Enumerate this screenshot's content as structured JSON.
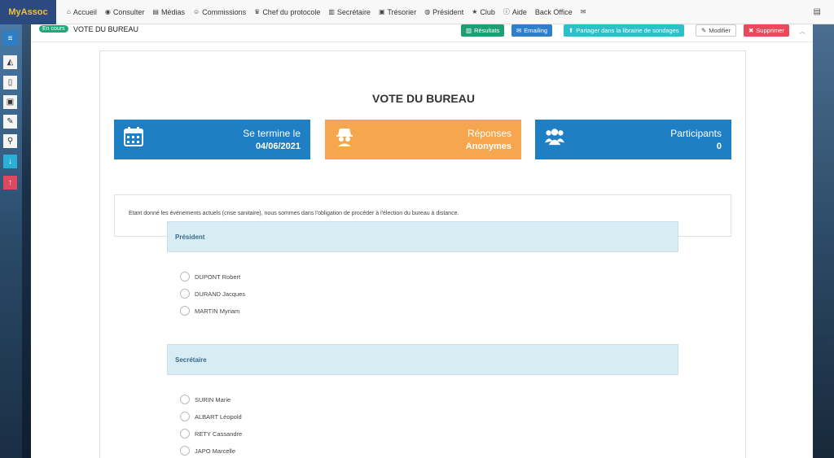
{
  "brand": "MyAssoc",
  "nav": [
    {
      "icon": "home-icon",
      "glyph": "⌂",
      "label": "Accueil"
    },
    {
      "icon": "eye-icon",
      "glyph": "◉",
      "label": "Consulter"
    },
    {
      "icon": "file-icon",
      "glyph": "▤",
      "label": "Médias"
    },
    {
      "icon": "user-circle-icon",
      "glyph": "☺",
      "label": "Commissions"
    },
    {
      "icon": "trophy-icon",
      "glyph": "♛",
      "label": "Chef du protocole"
    },
    {
      "icon": "book-icon",
      "glyph": "▥",
      "label": "Secrétaire"
    },
    {
      "icon": "money-icon",
      "glyph": "▣",
      "label": "Trésorier"
    },
    {
      "icon": "globe-icon",
      "glyph": "◍",
      "label": "Président"
    },
    {
      "icon": "star-icon",
      "glyph": "★",
      "label": "Club"
    },
    {
      "icon": "info-icon",
      "glyph": "ⓘ",
      "label": "Aide"
    },
    {
      "icon": "",
      "glyph": "",
      "label": "Back Office"
    },
    {
      "icon": "envelope-icon",
      "glyph": "✉",
      "label": ""
    }
  ],
  "header": {
    "badge": "En cours",
    "title": "VOTE DU BUREAU",
    "results_label": "Résultats",
    "email_label": "Emailing",
    "share_label": "Partager dans la librairie de sondages",
    "edit_label": "Modifier",
    "delete_label": "Supprimer"
  },
  "vote": {
    "title": "VOTE DU BUREAU",
    "stats": {
      "end": {
        "label": "Se termine le",
        "value": "04/06/2021"
      },
      "responses": {
        "label": "Réponses",
        "value": "Anonymes"
      },
      "participants": {
        "label": "Participants",
        "value": "0"
      }
    },
    "description": "Etant donné les événements actuels (crise sanitaire), nous sommes dans l'obligation de procéder à l'élection du bureau à distance.",
    "sections": [
      {
        "title": "Président",
        "options": [
          "DUPONT Robert",
          "DURAND Jacques",
          "MARTIN Myriam"
        ]
      },
      {
        "title": "Secrétaire",
        "options": [
          "SURIN Marie",
          "ALBART Léopold",
          "RETY Cassandre",
          "JAPO Marcelle"
        ]
      }
    ]
  },
  "colors": {
    "blue": "#1f7fc4",
    "orange": "#f6a64e",
    "green": "#1d9e74",
    "red": "#e84a5c",
    "teal": "#2ec0c8"
  }
}
